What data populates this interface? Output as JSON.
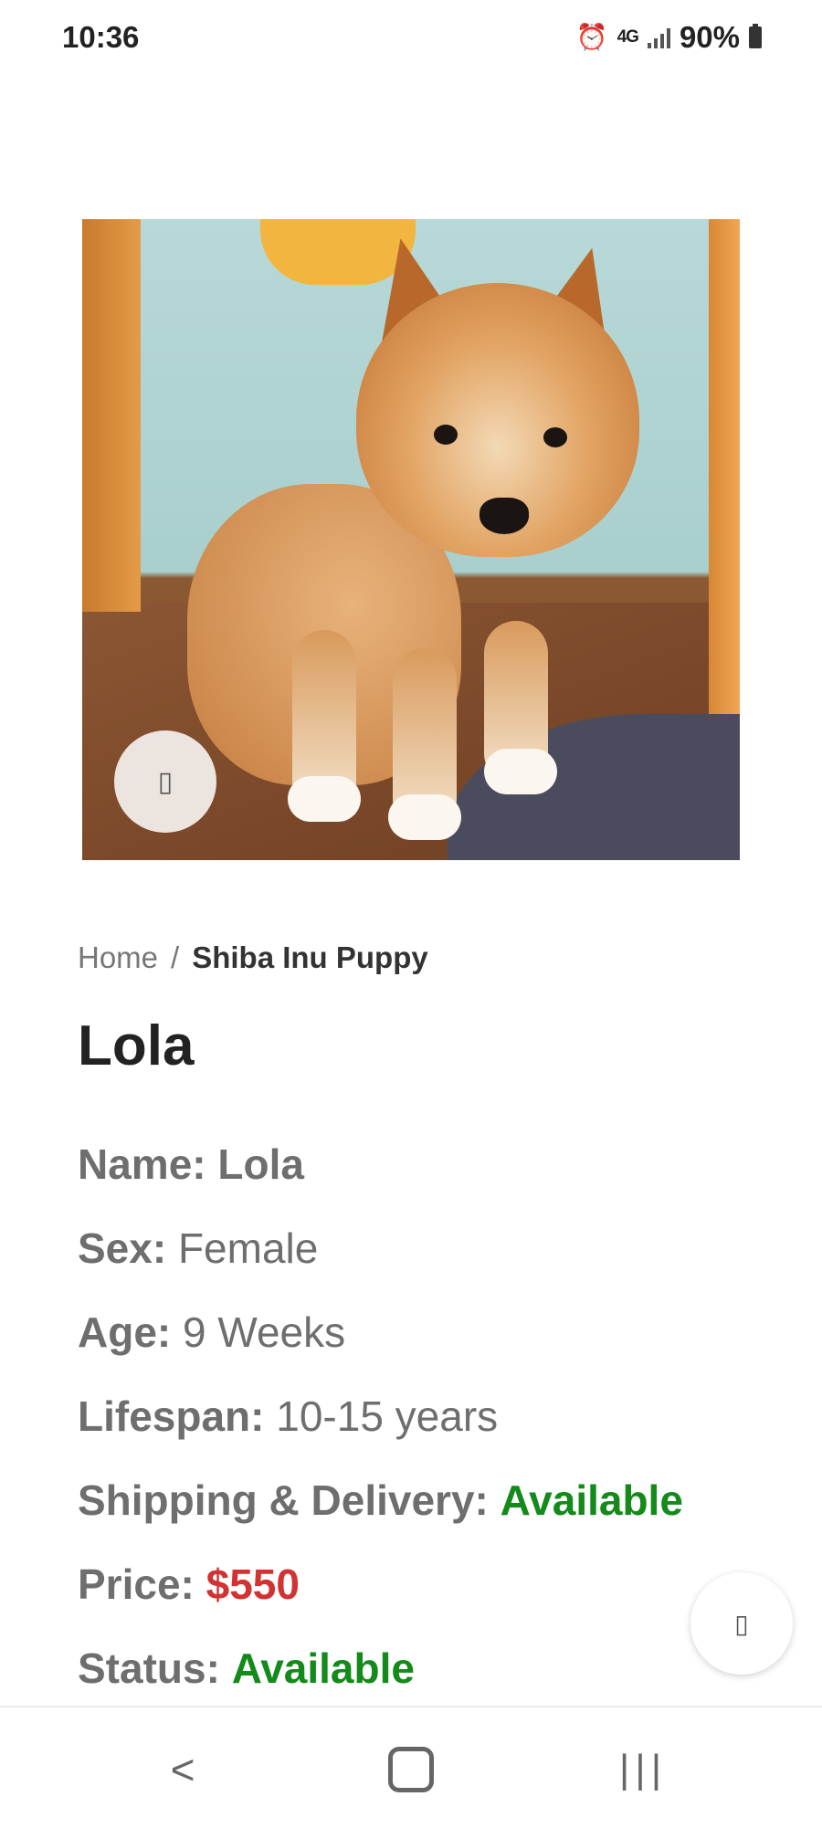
{
  "status_bar": {
    "time": "10:36",
    "network": "4G",
    "battery": "90%",
    "icons": [
      "alarm-icon",
      "network-4g-icon",
      "signal-icon",
      "battery-icon"
    ]
  },
  "product": {
    "breadcrumb": {
      "home": "Home",
      "separator": "/",
      "current": "Shiba Inu Puppy"
    },
    "title": "Lola",
    "details": [
      {
        "key": "Name:",
        "value": "Lola",
        "style": "plain-bold"
      },
      {
        "key": "Sex:",
        "value": "Female",
        "style": "plain"
      },
      {
        "key": "Age:",
        "value": "9 Weeks",
        "style": "plain"
      },
      {
        "key": "Lifespan:",
        "value": "10-15 years",
        "style": "plain"
      },
      {
        "key": "Shipping & Delivery:",
        "value": "Available",
        "style": "green"
      },
      {
        "key": "Price:",
        "value": "$550",
        "style": "red"
      },
      {
        "key": "Status:",
        "value": "Available",
        "style": "green"
      }
    ]
  },
  "buttons": {
    "zoom_icon": "zoom-icon",
    "floating_icon": "chat-icon"
  },
  "colors": {
    "available": "#138a1a",
    "price": "#d23232",
    "text": "#6e6e6e"
  },
  "nav_bar": {
    "back": "back-icon",
    "home": "home-icon",
    "recents": "recents-icon"
  }
}
